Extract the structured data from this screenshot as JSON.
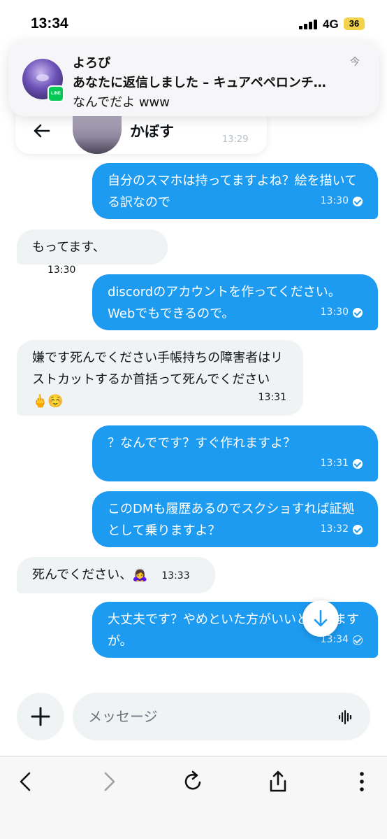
{
  "status_bar": {
    "time": "13:34",
    "network": "4G",
    "battery": "36"
  },
  "notification": {
    "sender": "よろぴ",
    "title": "あなたに返信しました – キュアペペロンチ…",
    "body": "なんでだよ www",
    "time": "今",
    "app_badge": "LINE"
  },
  "header": {
    "name": "かぼす",
    "faded_time": "13:29"
  },
  "messages": [
    {
      "dir": "out",
      "text": "自分のスマホは持ってますよね？絵を描いてる訳なので",
      "time": "13:30",
      "status": "read"
    },
    {
      "dir": "in",
      "text": "もってます、",
      "time": "13:30"
    },
    {
      "dir": "out",
      "text": "discordのアカウントを作ってください。Webでもできるので。",
      "time": "13:30",
      "status": "read"
    },
    {
      "dir": "in",
      "text": "嫌です死んでください手帳持ちの障害者はリストカットするか首括って死んでください🖕☺️",
      "time": "13:31"
    },
    {
      "dir": "out",
      "text": "？なんでです？すぐ作れますよ？",
      "time": "13:31",
      "status": "read"
    },
    {
      "dir": "out",
      "text": "このDMも履歴あるのでスクショすれば証拠として乗りますよ？",
      "time": "13:32",
      "status": "read"
    },
    {
      "dir": "in",
      "text": "死んでください、🙇‍♀️",
      "time": "13:33"
    },
    {
      "dir": "out",
      "text": "大丈夫です？やめといた方がいいと思いますが。",
      "time": "13:34",
      "status": "sent"
    }
  ],
  "composer": {
    "placeholder": "メッセージ"
  },
  "icons": {
    "back": "arrow-left-icon",
    "scroll_down": "arrow-down-icon",
    "plus": "plus-icon",
    "voice": "waveform-icon",
    "browser_back": "chevron-left-icon",
    "browser_forward": "chevron-right-icon",
    "reload": "reload-icon",
    "share": "share-icon",
    "more": "more-vertical-icon"
  },
  "colors": {
    "outgoing_bubble": "#1d9bf0",
    "incoming_bubble": "#eff3f4",
    "line_green": "#06c755",
    "battery": "#f4d34c"
  }
}
